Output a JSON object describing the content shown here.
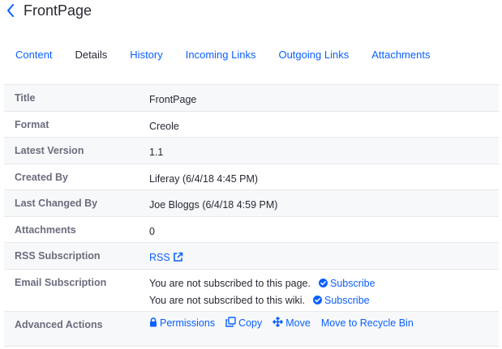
{
  "header": {
    "title": "FrontPage",
    "back_icon": "chevron-left-icon"
  },
  "tabs": [
    {
      "label": "Content",
      "active": false
    },
    {
      "label": "Details",
      "active": true
    },
    {
      "label": "History",
      "active": false
    },
    {
      "label": "Incoming Links",
      "active": false
    },
    {
      "label": "Outgoing Links",
      "active": false
    },
    {
      "label": "Attachments",
      "active": false
    }
  ],
  "details": {
    "title": {
      "label": "Title",
      "value": "FrontPage"
    },
    "format": {
      "label": "Format",
      "value": "Creole"
    },
    "latest_version": {
      "label": "Latest Version",
      "value": "1.1"
    },
    "created_by": {
      "label": "Created By",
      "value": "Liferay (6/4/18 4:45 PM)"
    },
    "last_changed_by": {
      "label": "Last Changed By",
      "value": "Joe Bloggs (6/4/18 4:59 PM)"
    },
    "attachments": {
      "label": "Attachments",
      "value": "0"
    },
    "rss_subscription": {
      "label": "RSS Subscription",
      "link": "RSS",
      "icon": "external-link-icon"
    },
    "email_subscription": {
      "label": "Email Subscription",
      "page_text": "You are not subscribed to this page.",
      "page_link": "Subscribe",
      "wiki_text": "You are not subscribed to this wiki.",
      "wiki_link": "Subscribe",
      "icon": "check-circle-icon"
    },
    "advanced_actions": {
      "label": "Advanced Actions",
      "permissions": "Permissions",
      "copy": "Copy",
      "move": "Move",
      "recycle": "Move to Recycle Bin"
    }
  },
  "colors": {
    "link": "#0b5fff",
    "text": "#272833",
    "label": "#6b6c7e",
    "row_alt": "#f7f8f9",
    "border": "#e7e7ed"
  }
}
